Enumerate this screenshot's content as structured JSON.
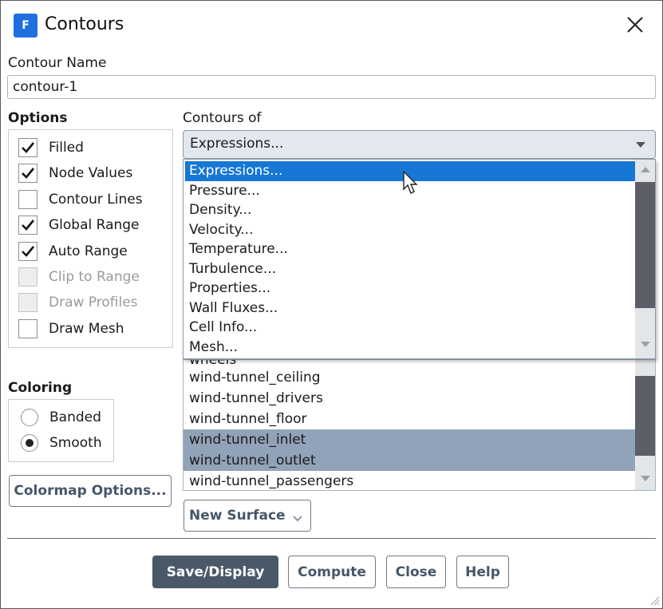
{
  "window": {
    "title": "Contours",
    "app_icon_letter": "F"
  },
  "contour_name": {
    "label": "Contour Name",
    "value": "contour-1"
  },
  "options": {
    "label": "Options",
    "items": [
      {
        "label": "Filled",
        "checked": true,
        "enabled": true
      },
      {
        "label": "Node Values",
        "checked": true,
        "enabled": true
      },
      {
        "label": "Contour Lines",
        "checked": false,
        "enabled": true
      },
      {
        "label": "Global Range",
        "checked": true,
        "enabled": true
      },
      {
        "label": "Auto Range",
        "checked": true,
        "enabled": true
      },
      {
        "label": "Clip to Range",
        "checked": false,
        "enabled": false
      },
      {
        "label": "Draw Profiles",
        "checked": false,
        "enabled": false
      },
      {
        "label": "Draw Mesh",
        "checked": false,
        "enabled": true
      }
    ]
  },
  "coloring": {
    "label": "Coloring",
    "items": [
      {
        "label": "Banded",
        "selected": false
      },
      {
        "label": "Smooth",
        "selected": true
      }
    ]
  },
  "contours_of": {
    "label": "Contours of",
    "selected": "Expressions...",
    "options": [
      "Expressions...",
      "Pressure...",
      "Density...",
      "Velocity...",
      "Temperature...",
      "Turbulence...",
      "Properties...",
      "Wall Fluxes...",
      "Cell Info...",
      "Mesh..."
    ]
  },
  "surfaces": {
    "partial_item": "wheels",
    "items": [
      {
        "label": "wind-tunnel_ceiling",
        "selected": false
      },
      {
        "label": "wind-tunnel_drivers",
        "selected": false
      },
      {
        "label": "wind-tunnel_floor",
        "selected": false
      },
      {
        "label": "wind-tunnel_inlet",
        "selected": true
      },
      {
        "label": "wind-tunnel_outlet",
        "selected": true
      },
      {
        "label": "wind-tunnel_passengers",
        "selected": false
      }
    ]
  },
  "buttons": {
    "colormap_options": "Colormap Options...",
    "new_surface": "New Surface",
    "save_display": "Save/Display",
    "compute": "Compute",
    "close": "Close",
    "help": "Help"
  },
  "colors": {
    "accent": "#1677d4",
    "selection": "#91a3b8",
    "primary_button": "#4a5869"
  }
}
